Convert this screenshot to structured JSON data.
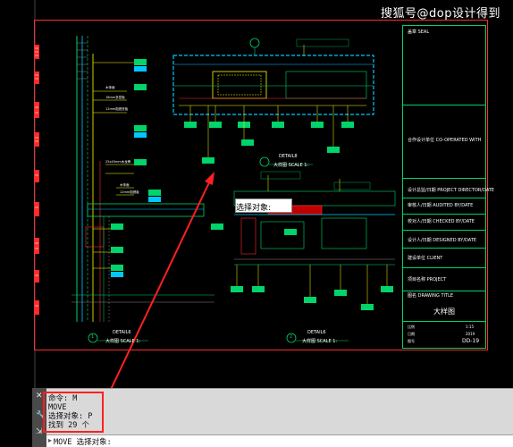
{
  "watermark": "搜狐号@dop设计得到",
  "title_block": {
    "seal": "盖章 SEAL",
    "cooperator": "合作设计单位 CO-OPERATED WITH",
    "project_director": "设计总监/日期 PROJECT DIRECTOR/DATE",
    "audited_by": "审核人/日期 AUDITED BY/DATE",
    "checked_by": "校对人/日期 CHECKED BY/DATE",
    "designed_by": "设计人/日期 DESIGNED BY/DATE",
    "client": "建设单位 CLIENT",
    "project": "项目名称 PROJECT",
    "drawing_title_label": "图名 DRAWING TITLE",
    "drawing_title": "大样图",
    "scale_label": "比例",
    "scale_value": "1:15",
    "date_label": "日期",
    "date_value": "2019",
    "drawing_no_label": "图号",
    "drawing_no": "DD-19"
  },
  "details": {
    "detail_a": "DETAIL6",
    "detail_a_scale": "大样图  SCALE 1:",
    "detail_b": "DETAIL8",
    "detail_b_scale": "大样图  SCALE 1:",
    "detail_c": "DETAIL6",
    "detail_c_scale": "大样图  SCALE 1:",
    "mark_1": "1",
    "mark_2": "2"
  },
  "canvas_tooltip": "选择对象:",
  "command_line": {
    "history": [
      "命令: M",
      "MOVE",
      "选择对象: P",
      "找到 29 个"
    ],
    "prompt_prefix": "MOVE 选择对象:",
    "input_value": ""
  },
  "colors": {
    "canvas_bg": "#000000",
    "sheet_border": "#ff2b2b",
    "cad_green": "#00d46a",
    "cad_cyan": "#00c8ff",
    "cad_yellow": "#ffff00",
    "annotation_red": "#ff2020"
  },
  "icons": {
    "close": "close-icon",
    "wrench": "wrench-icon",
    "customize": "customize-icon"
  }
}
